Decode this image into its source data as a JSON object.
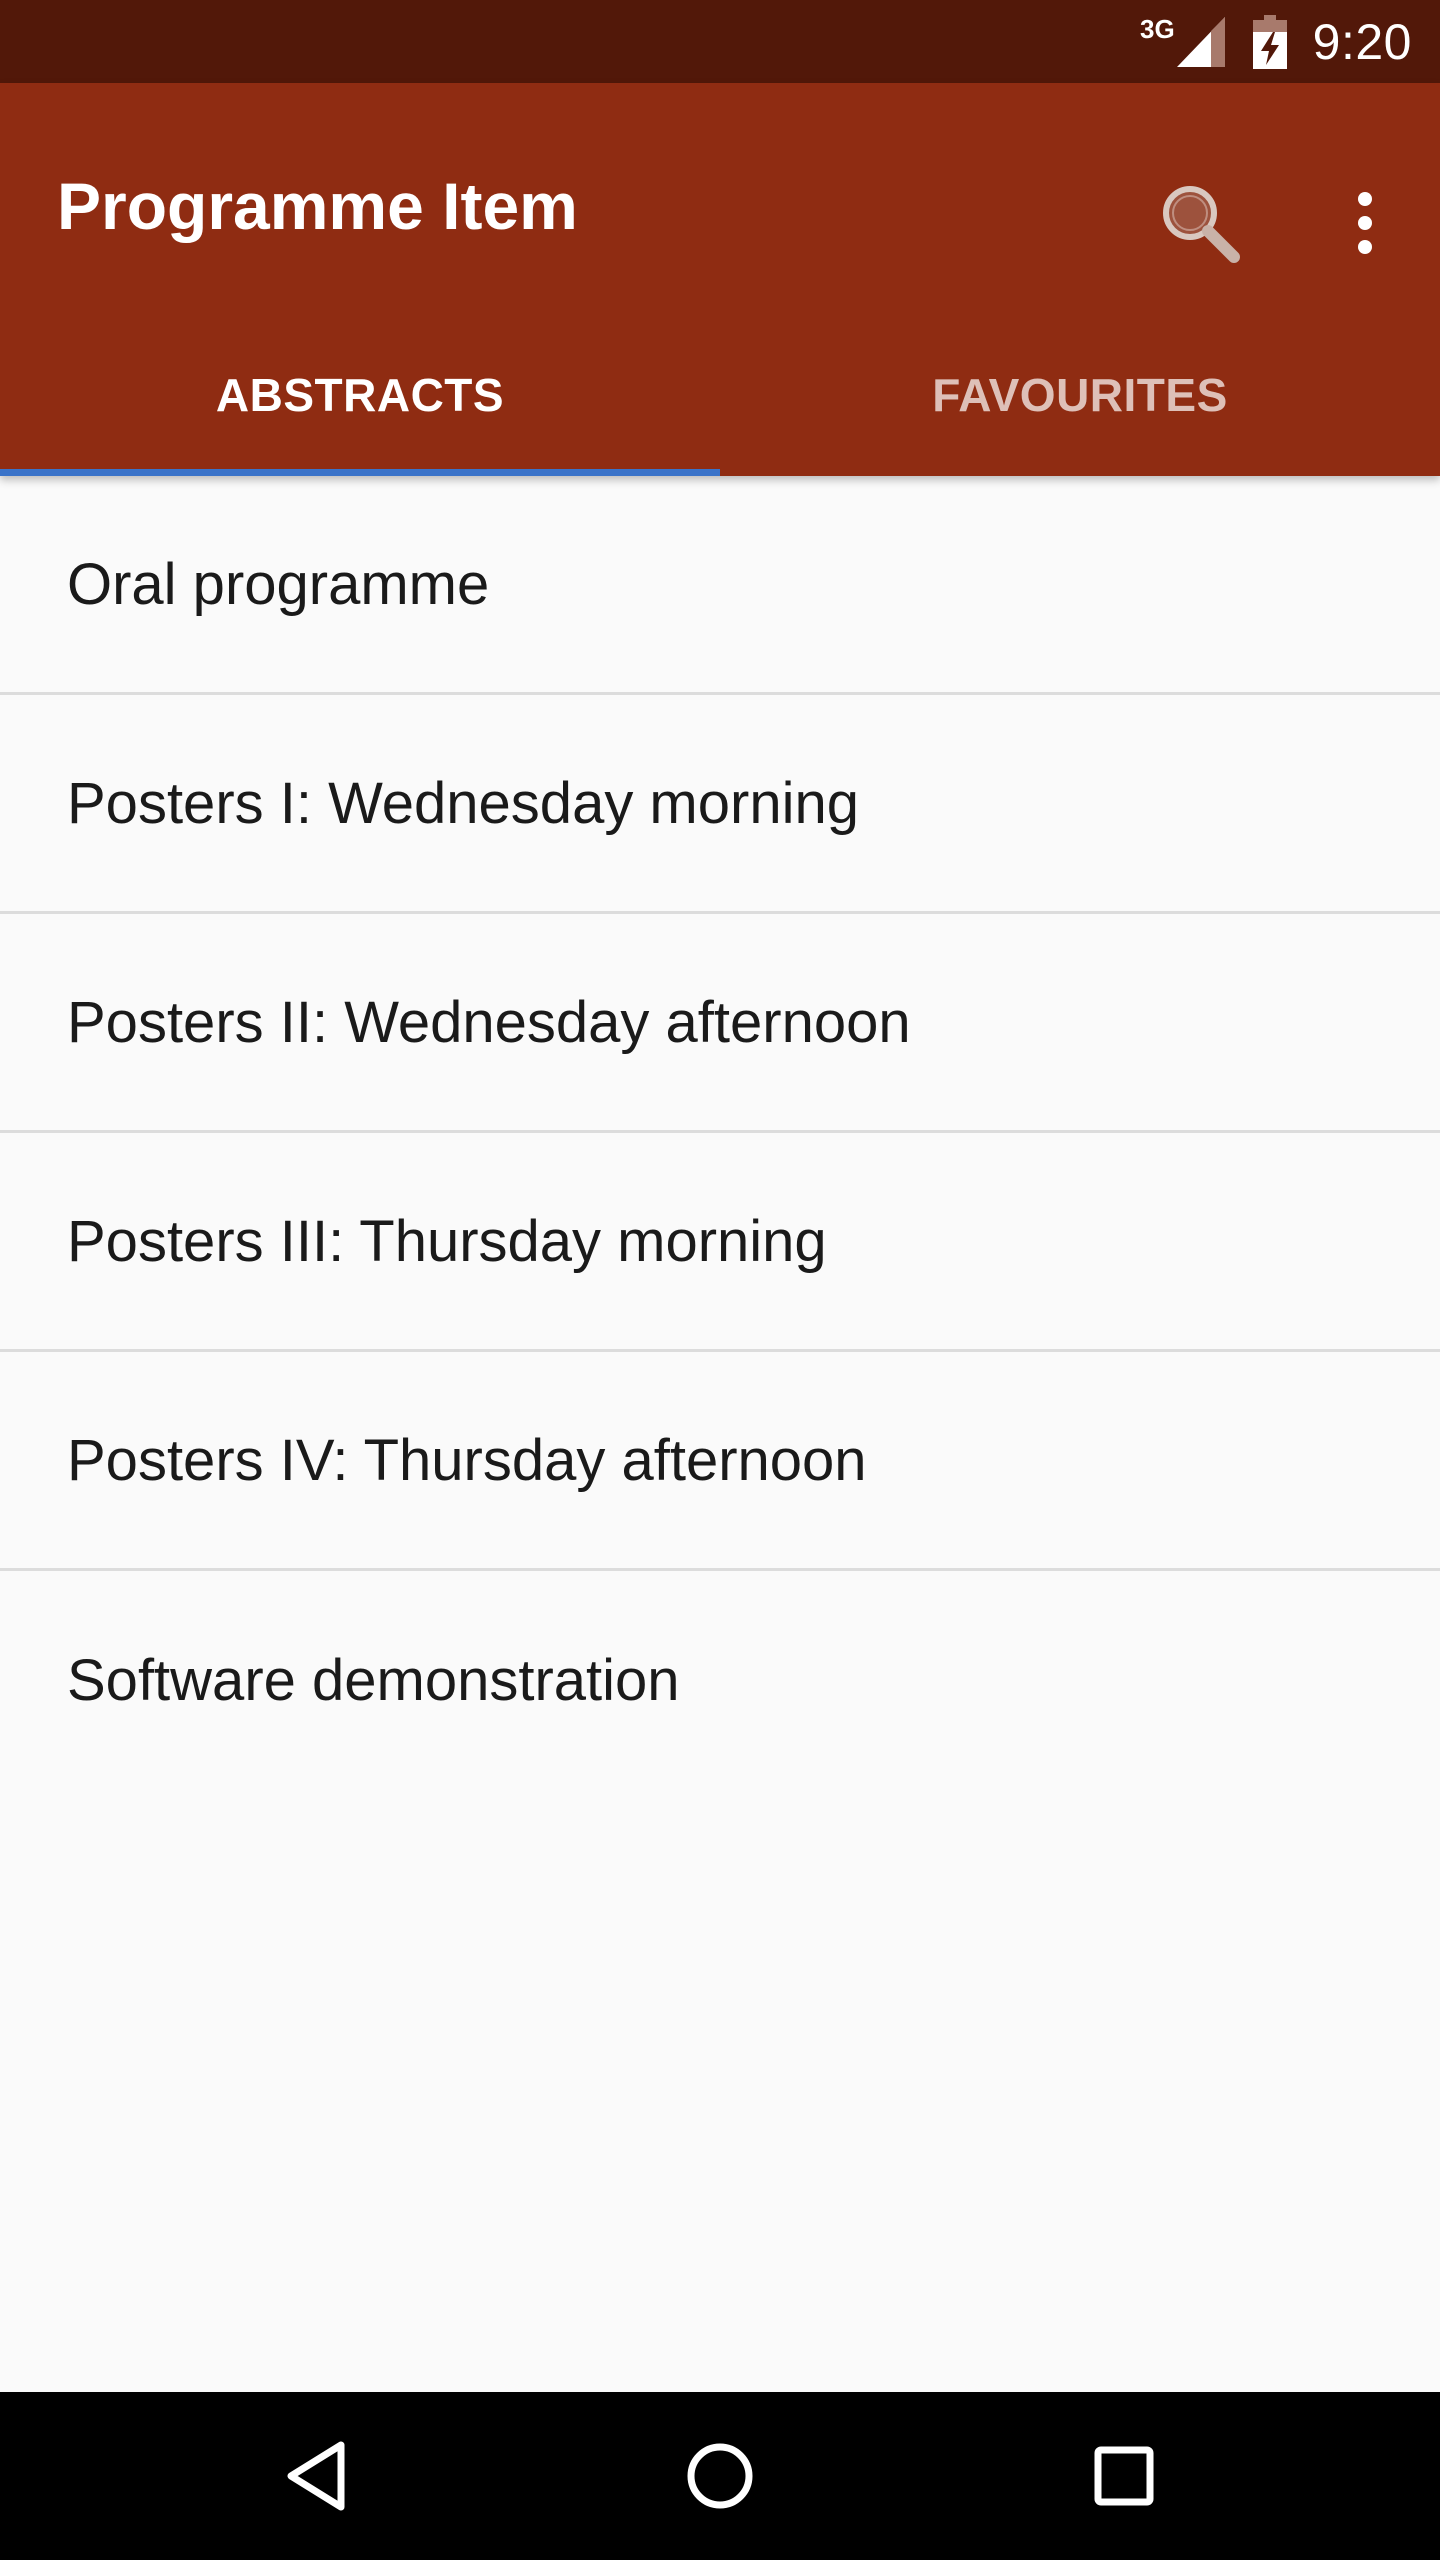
{
  "status_bar": {
    "network": "3G",
    "time": "9:20",
    "icons": [
      "signal-icon",
      "battery-charging-icon"
    ]
  },
  "app_bar": {
    "title": "Programme Item",
    "actions": [
      "search-icon",
      "more-vert-icon"
    ],
    "color": "#8f2c12"
  },
  "tabs": [
    {
      "label": "ABSTRACTS",
      "active": true
    },
    {
      "label": "FAVOURITES",
      "active": false
    }
  ],
  "list": {
    "items": [
      {
        "label": "Oral programme"
      },
      {
        "label": "Posters I: Wednesday morning"
      },
      {
        "label": "Posters II: Wednesday afternoon"
      },
      {
        "label": "Posters III: Thursday morning"
      },
      {
        "label": "Posters IV: Thursday afternoon"
      },
      {
        "label": "Software demonstration"
      }
    ]
  },
  "nav_bar": {
    "buttons": [
      "back-icon",
      "home-icon",
      "recents-icon"
    ]
  },
  "colors": {
    "status_bar": "#521809",
    "app_bar": "#8f2c12",
    "tab_indicator": "#3a73c9",
    "background": "#fafafa"
  }
}
